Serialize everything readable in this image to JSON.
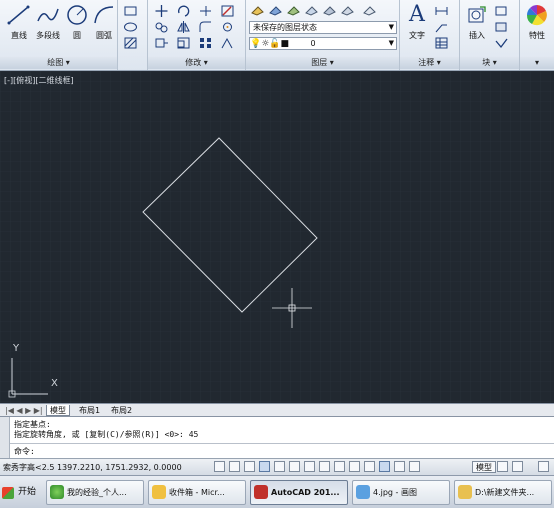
{
  "ribbon": {
    "draw_panel": {
      "title": "绘图 ▾",
      "line_label": "直线",
      "polyline_label": "多段线",
      "circle_label": "圆",
      "arc_label": "圆弧"
    },
    "modify_panel": {
      "title": "修改 ▾"
    },
    "layers_panel": {
      "title": "图层 ▾",
      "layer_state_value": "未保存的图层状态",
      "current_layer_value": "0"
    },
    "annotation_panel": {
      "title": "注释 ▾",
      "text_label": "文字",
      "text_icon": "A"
    },
    "block_panel": {
      "title": "块 ▾",
      "insert_label": "插入"
    },
    "properties_panel": {
      "label": "特性",
      "more_icon": "▾"
    }
  },
  "viewport": {
    "label": "[-][俯视][二维线框]",
    "ucs_y": "Y",
    "ucs_x": "X",
    "bg_color": "#212830",
    "rect_color": "#d9dde2"
  },
  "layout_tabs": {
    "nav": "|◀ ◀ ▶ ▶|",
    "model": "模型",
    "layout1": "布局1",
    "layout2": "布局2"
  },
  "command": {
    "history1": "指定基点:",
    "history2": "指定旋转角度, 或 [复制(C)/参照(R)] <0>:  45",
    "prompt": "命令:"
  },
  "status_bar": {
    "coordinates": "索秀字高<2.5  1397.2210, 1751.2932, 0.0000",
    "model_button": "模型"
  },
  "taskbar": {
    "start": "开始",
    "items": [
      "我的经验_个人...",
      "收件箱 - Micr...",
      "AutoCAD 201...",
      "4.jpg - 画图",
      "D:\\新建文件夹..."
    ]
  }
}
